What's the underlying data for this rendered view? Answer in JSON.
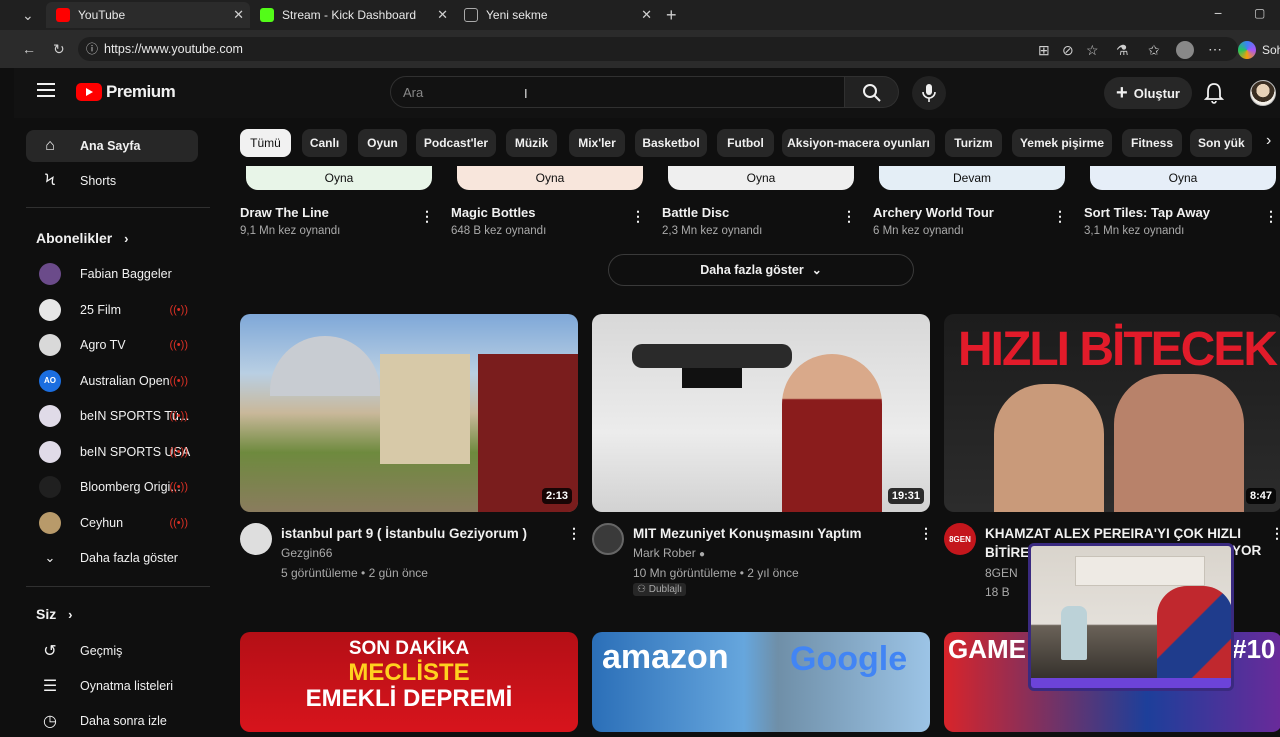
{
  "browser": {
    "tabs": [
      {
        "title": "YouTube",
        "active": true
      },
      {
        "title": "Stream - Kick Dashboard",
        "active": false
      },
      {
        "title": "Yeni sekme",
        "active": false
      }
    ],
    "url": "https://www.youtube.com",
    "copilot_label": "Soh"
  },
  "masthead": {
    "logo_text": "Premium",
    "search_placeholder": "Ara",
    "create_label": "Oluştur"
  },
  "sidebar": {
    "main": [
      {
        "label": "Ana Sayfa",
        "icon": "home-icon"
      },
      {
        "label": "Shorts",
        "icon": "shorts-icon"
      }
    ],
    "subscriptions_title": "Abonelikler",
    "subscriptions": [
      {
        "label": "Fabian Baggeler",
        "color": "#6b4b8a",
        "live": false
      },
      {
        "label": "25 Film",
        "color": "#e6e6e6",
        "live": true
      },
      {
        "label": "Agro TV",
        "color": "#d9d9d9",
        "live": true
      },
      {
        "label": "Australian Open",
        "color": "#1b6ee0",
        "avatar_text": "AO",
        "live": true
      },
      {
        "label": "beIN SPORTS Tü...",
        "color": "#e0dbe8",
        "live": true
      },
      {
        "label": "beIN SPORTS USA",
        "color": "#e0dbe8",
        "live": true
      },
      {
        "label": "Bloomberg Origi...",
        "color": "#202020",
        "live": true
      },
      {
        "label": "Ceyhun",
        "color": "#b89a6a",
        "live": true
      }
    ],
    "show_more": "Daha fazla göster",
    "you_title": "Siz",
    "you": [
      {
        "label": "Geçmiş",
        "icon": "history-icon"
      },
      {
        "label": "Oynatma listeleri",
        "icon": "playlist-icon"
      },
      {
        "label": "Daha sonra izle",
        "icon": "watch-later-icon"
      }
    ]
  },
  "chips": [
    "Tümü",
    "Canlı",
    "Oyun",
    "Podcast'ler",
    "Müzik",
    "Mix'ler",
    "Basketbol",
    "Futbol",
    "Aksiyon-macera oyunları",
    "Turizm",
    "Yemek pişirme",
    "Fitness",
    "Son yük"
  ],
  "games": [
    {
      "button": "Oyna",
      "title": "Draw The Line",
      "meta": "9,1 Mn kez oynandı",
      "btn_color": "#e8f5e8"
    },
    {
      "button": "Oyna",
      "title": "Magic Bottles",
      "meta": "648 B kez oynandı",
      "btn_color": "#f8e6dc"
    },
    {
      "button": "Oyna",
      "title": "Battle Disc",
      "meta": "2,3 Mn kez oynandı",
      "btn_color": "#efefef"
    },
    {
      "button": "Devam",
      "title": "Archery World Tour",
      "meta": "6 Mn kez oynandı",
      "btn_color": "#e4eef6"
    },
    {
      "button": "Oyna",
      "title": "Sort Tiles: Tap Away",
      "meta": "3,1 Mn kez oynandı",
      "btn_color": "#e6eef8"
    }
  ],
  "show_more_games": "Daha fazla göster",
  "videos": [
    {
      "title": "istanbul part 9 ( İstanbulu Geziyorum )",
      "channel": "Gezgin66",
      "stats": "5 görüntüleme • 2 gün önce",
      "duration": "2:13"
    },
    {
      "title": "MIT Mezuniyet Konuşmasını Yaptım",
      "channel": "Mark Rober",
      "stats": "10 Mn görüntüleme • 2 yıl önce",
      "duration": "19:31",
      "badge": "Dublajlı"
    },
    {
      "title": "KHAMZAT ALEX PEREIRA'YI ÇOK HIZLI BİTİRE",
      "title_end": "YOR",
      "channel": "8GEN",
      "stats": "18 B",
      "duration": "8:47",
      "thumb_text": "HIZLI BİTECEK",
      "avatar_text": "8GEN"
    }
  ],
  "row2": [
    {
      "text_line1": "SON DAKİKA",
      "text_line2": "MECLİSTE",
      "text_line3": "EMEKLİ DEPREMİ"
    },
    {
      "text_left": "amazon",
      "text_right": "Google"
    },
    {
      "text_left": "GAME",
      "text_right": "#10"
    }
  ],
  "colors": {
    "accent": "#ff0000",
    "bg": "#0f0f0f",
    "live": "#d93025"
  }
}
